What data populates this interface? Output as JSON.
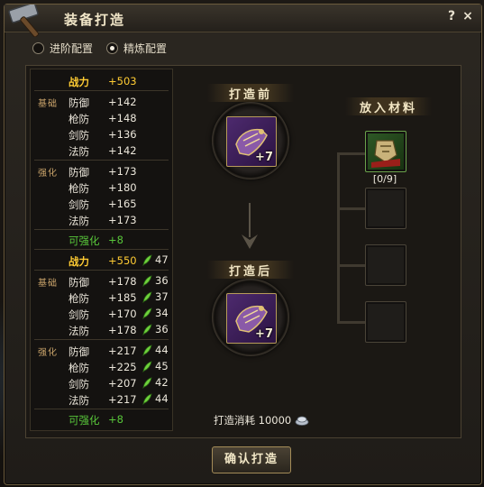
{
  "window": {
    "title": "装备打造",
    "help": "?",
    "close": "×"
  },
  "config_options": [
    {
      "label": "进阶配置",
      "selected": false
    },
    {
      "label": "精炼配置",
      "selected": true
    }
  ],
  "before": {
    "group_labels": {
      "base": "基础",
      "enhance": "强化"
    },
    "power": {
      "name": "战力",
      "value": "+503"
    },
    "base": [
      {
        "name": "防御",
        "value": "+142"
      },
      {
        "name": "枪防",
        "value": "+148"
      },
      {
        "name": "剑防",
        "value": "+136"
      },
      {
        "name": "法防",
        "value": "+142"
      }
    ],
    "enhance": [
      {
        "name": "防御",
        "value": "+173"
      },
      {
        "name": "枪防",
        "value": "+180"
      },
      {
        "name": "剑防",
        "value": "+165"
      },
      {
        "name": "法防",
        "value": "+173"
      }
    ],
    "enhanceable": {
      "name": "可强化",
      "value": "+8"
    }
  },
  "after": {
    "group_labels": {
      "base": "基础",
      "enhance": "强化"
    },
    "power": {
      "name": "战力",
      "value": "+550",
      "gain": "47"
    },
    "base": [
      {
        "name": "防御",
        "value": "+178",
        "gain": "36"
      },
      {
        "name": "枪防",
        "value": "+185",
        "gain": "37"
      },
      {
        "name": "剑防",
        "value": "+170",
        "gain": "34"
      },
      {
        "name": "法防",
        "value": "+178",
        "gain": "36"
      }
    ],
    "enhance": [
      {
        "name": "防御",
        "value": "+217",
        "gain": "44"
      },
      {
        "name": "枪防",
        "value": "+225",
        "gain": "45"
      },
      {
        "name": "剑防",
        "value": "+207",
        "gain": "42"
      },
      {
        "name": "法防",
        "value": "+217",
        "gain": "44"
      }
    ],
    "enhanceable": {
      "name": "可强化",
      "value": "+8"
    }
  },
  "forge": {
    "before_label": "打造前",
    "after_label": "打造后",
    "before_item_plus": "+7",
    "after_item_plus": "+7",
    "materials_label": "放入材料",
    "material_count": "[0/9]",
    "cost_text": "打造消耗 10000",
    "confirm_button": "确认打造"
  },
  "colors": {
    "highlight": "#ffcc33",
    "green": "#58c63a",
    "gold_border": "#b79b5a"
  },
  "icons": [
    "hammer-icon",
    "help-icon",
    "close-icon",
    "leaf-arrow-icon",
    "silver-coin-icon",
    "down-arrow-icon"
  ]
}
